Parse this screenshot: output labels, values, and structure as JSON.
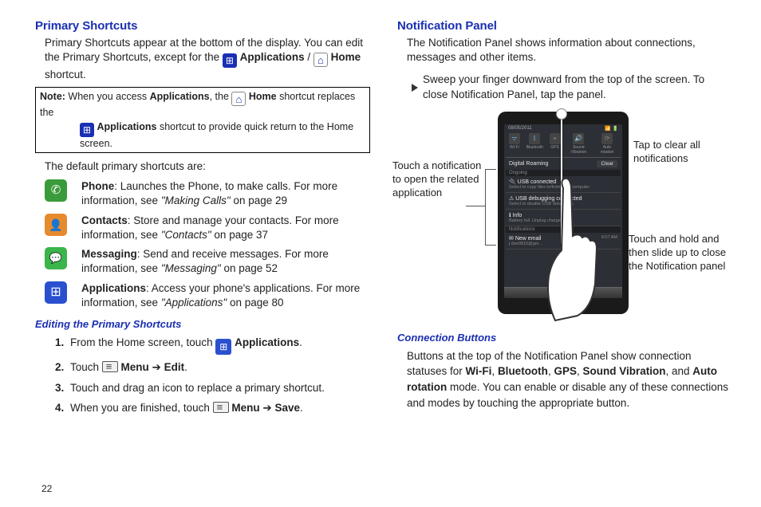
{
  "left": {
    "h_primary": "Primary Shortcuts",
    "p1a": "Primary Shortcuts appear at the bottom of the display. You can edit the Primary Shortcuts, except for the ",
    "apps_label": "Applications",
    "p1b": " / ",
    "home_label": "Home",
    "p1c": " shortcut.",
    "note_lead": "Note:",
    "note_a": " When you access ",
    "note_apps": "Applications",
    "note_b": ", the ",
    "note_home": "Home",
    "note_c": " shortcut replaces the ",
    "note_apps2": "Applications",
    "note_d": " shortcut to provide quick return to the Home screen.",
    "p2": "The default primary shortcuts are:",
    "items": [
      {
        "title": "Phone",
        "desc": ": Launches the Phone, to make calls. For more information, see ",
        "ref": "\"Making Calls\"",
        "page": " on page 29"
      },
      {
        "title": "Contacts",
        "desc": ": Store and manage your contacts. For more information, see ",
        "ref": "\"Contacts\"",
        "page": " on page 37"
      },
      {
        "title": "Messaging",
        "desc": ": Send and receive messages. For more information, see ",
        "ref": "\"Messaging\"",
        "page": " on page 52"
      },
      {
        "title": "Applications",
        "desc": ": Access your phone's applications. For more information, see ",
        "ref": "\"Applications\"",
        "page": " on page 80"
      }
    ],
    "h_edit": "Editing the Primary Shortcuts",
    "steps": {
      "s1a": "From the Home screen, touch ",
      "s1b": "Applications",
      "s1c": ".",
      "s2a": "Touch ",
      "s2_menu": "Menu",
      "s2_edit": "Edit",
      "s2c": ".",
      "s3": "Touch and drag an icon to replace a primary shortcut.",
      "s4a": "When you are finished, touch ",
      "s4_menu": "Menu",
      "s4_save": "Save",
      "s4c": "."
    }
  },
  "right": {
    "h_notif": "Notification Panel",
    "p1": "The Notification Panel shows information about connections, messages and other items.",
    "sweep": "Sweep your finger downward from the top of the screen. To close Notification Panel, tap the panel.",
    "labels": {
      "left": "Touch a notification to open the related application",
      "right_top": "Tap to clear all notifications",
      "right_bot": "Touch and hold and then slide up to close the Notification panel"
    },
    "phone_ui": {
      "date": "08/05/2011",
      "toggles": [
        "Wi-Fi",
        "Bluetooth",
        "GPS",
        "Sound Vibration",
        "Auto rotation"
      ],
      "roaming": "Digital Roaming",
      "clear": "Clear",
      "ongoing": "Ongoing",
      "n1_t": "USB connected",
      "n1_s": "Select to copy files to/from your computer",
      "n2_t": "USB debugging connected",
      "n2_s": "Select to disable USB debugging.",
      "n3_t": "Info",
      "n3_s": "Battery full. Unplug charger",
      "notif_hdr": "Notifications",
      "n4_t": "New email",
      "n4_s": "j.doe0816@gm…",
      "n4_time": "8:07 AM"
    },
    "h_conn": "Connection Buttons",
    "conn_a": "Buttons at the top of the Notification Panel show connection statuses for ",
    "conn_list": [
      "Wi-Fi",
      "Bluetooth",
      "GPS",
      "Sound Vibration",
      "Auto rotation"
    ],
    "conn_b": " mode. You can enable or disable any of these connections and modes by touching the appropriate button."
  },
  "page_number": "22"
}
